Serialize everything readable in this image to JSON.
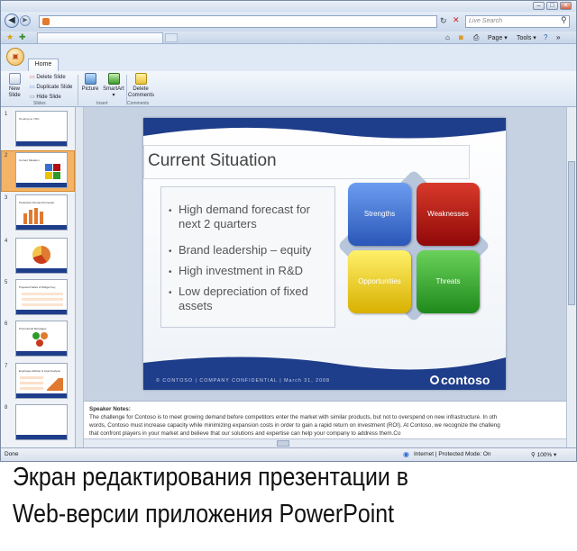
{
  "browser": {
    "search_placeholder": "Live Search",
    "page_menu": "Page",
    "tools_menu": "Tools"
  },
  "ribbon": {
    "tab_home": "Home",
    "new_slide": "New Slide",
    "delete_slide": "Delete Slide",
    "duplicate_slide": "Duplicate Slide",
    "hide_slide": "Hide Slide",
    "group_slides": "Slides",
    "picture": "Picture",
    "smartart": "SmartArt",
    "group_insert": "Insert",
    "delete_comments": "Delete Comments",
    "group_comments": "Comments"
  },
  "thumbnails": [
    {
      "num": "1",
      "title": "It's all up to YOU"
    },
    {
      "num": "2",
      "title": "Current Situation"
    },
    {
      "num": "3",
      "title": "Production Demand Forecast"
    },
    {
      "num": "4",
      "title": ""
    },
    {
      "num": "5",
      "title": "Projected Sales of Widget Key"
    },
    {
      "num": "6",
      "title": "Promotional Messages"
    },
    {
      "num": "7",
      "title": "Employee Attrition & Cost Analysis"
    },
    {
      "num": "8",
      "title": ""
    }
  ],
  "slide": {
    "title": "Current Situation",
    "bullets": [
      "High demand forecast for next 2 quarters",
      "Brand leadership – equity",
      "High investment in R&D",
      "Low depreciation of fixed assets"
    ],
    "quadrants": {
      "strengths": "Strengths",
      "weaknesses": "Weaknesses",
      "opportunities": "Opportunities",
      "threats": "Threats"
    },
    "footer": "© CONTOSO | COMPANY CONFIDENTIAL | March 31, 2008",
    "brand": "contoso",
    "colors": {
      "strengths": "#3a6fd0",
      "weaknesses": "#b01010",
      "opportunities": "#e8c400",
      "threats": "#2d9a2a",
      "band": "#1e3d8a"
    }
  },
  "notes": {
    "label": "Speaker Notes:",
    "line1": "The challenge for Contoso is to meet growing demand before competitors enter the market with similar products, but not to overspend on new infrastructure. In oth",
    "line2": "words, Contoso must increase capacity while minimizing expansion costs in order to gain a rapid return on investment (ROI). At Contoso, we recognize the challeng",
    "line3": "that confront players in your market and believe that our solutions and expertise can help your company to address them.Co"
  },
  "status": {
    "left": "Done",
    "zone": "Internet | Protected Mode: On",
    "zoom": "100%"
  },
  "caption": {
    "line1": "Экран редактирования презентации в",
    "line2": "Web-версии приложения PowerPoint"
  }
}
